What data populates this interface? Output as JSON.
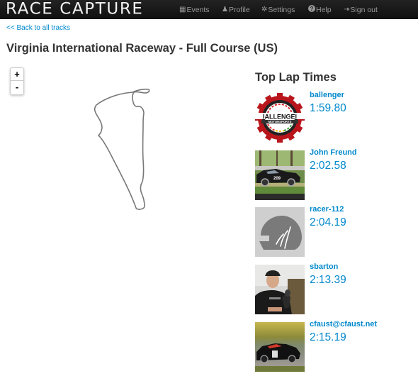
{
  "navbar": {
    "brand": "RACE CAPTURE",
    "items": [
      {
        "icon": "calendar-icon",
        "glyph": "▦",
        "label": "Events"
      },
      {
        "icon": "user-icon",
        "glyph": "♟",
        "label": "Profile"
      },
      {
        "icon": "gear-icon",
        "glyph": "✲",
        "label": "Settings"
      },
      {
        "icon": "help-icon",
        "glyph": "❓",
        "label": "Help"
      },
      {
        "icon": "sign-out-icon",
        "glyph": "⇥",
        "label": "Sign out"
      }
    ]
  },
  "back_link": "<< Back to all tracks",
  "page_title": "Virginia International Raceway - Full Course (US)",
  "map": {
    "zoom_in": "+",
    "zoom_out": "-"
  },
  "laps": {
    "title": "Top Lap Times",
    "entries": [
      {
        "name": "ballenger",
        "time": "1:59.80",
        "avatar": "ballenger-motorsports-logo"
      },
      {
        "name": "John Freund",
        "time": "2:02.58",
        "avatar": "race-car-photo"
      },
      {
        "name": "racer-112",
        "time": "2:04.19",
        "avatar": "default-helmet-avatar"
      },
      {
        "name": "sbarton",
        "time": "2:13.39",
        "avatar": "driver-photo"
      },
      {
        "name": "cfaust@cfaust.net",
        "time": "2:15.19",
        "avatar": "race-car-photo"
      }
    ]
  },
  "colors": {
    "link": "#0088cc",
    "navbar": "#1b1b1b",
    "track_line": "#777777"
  }
}
